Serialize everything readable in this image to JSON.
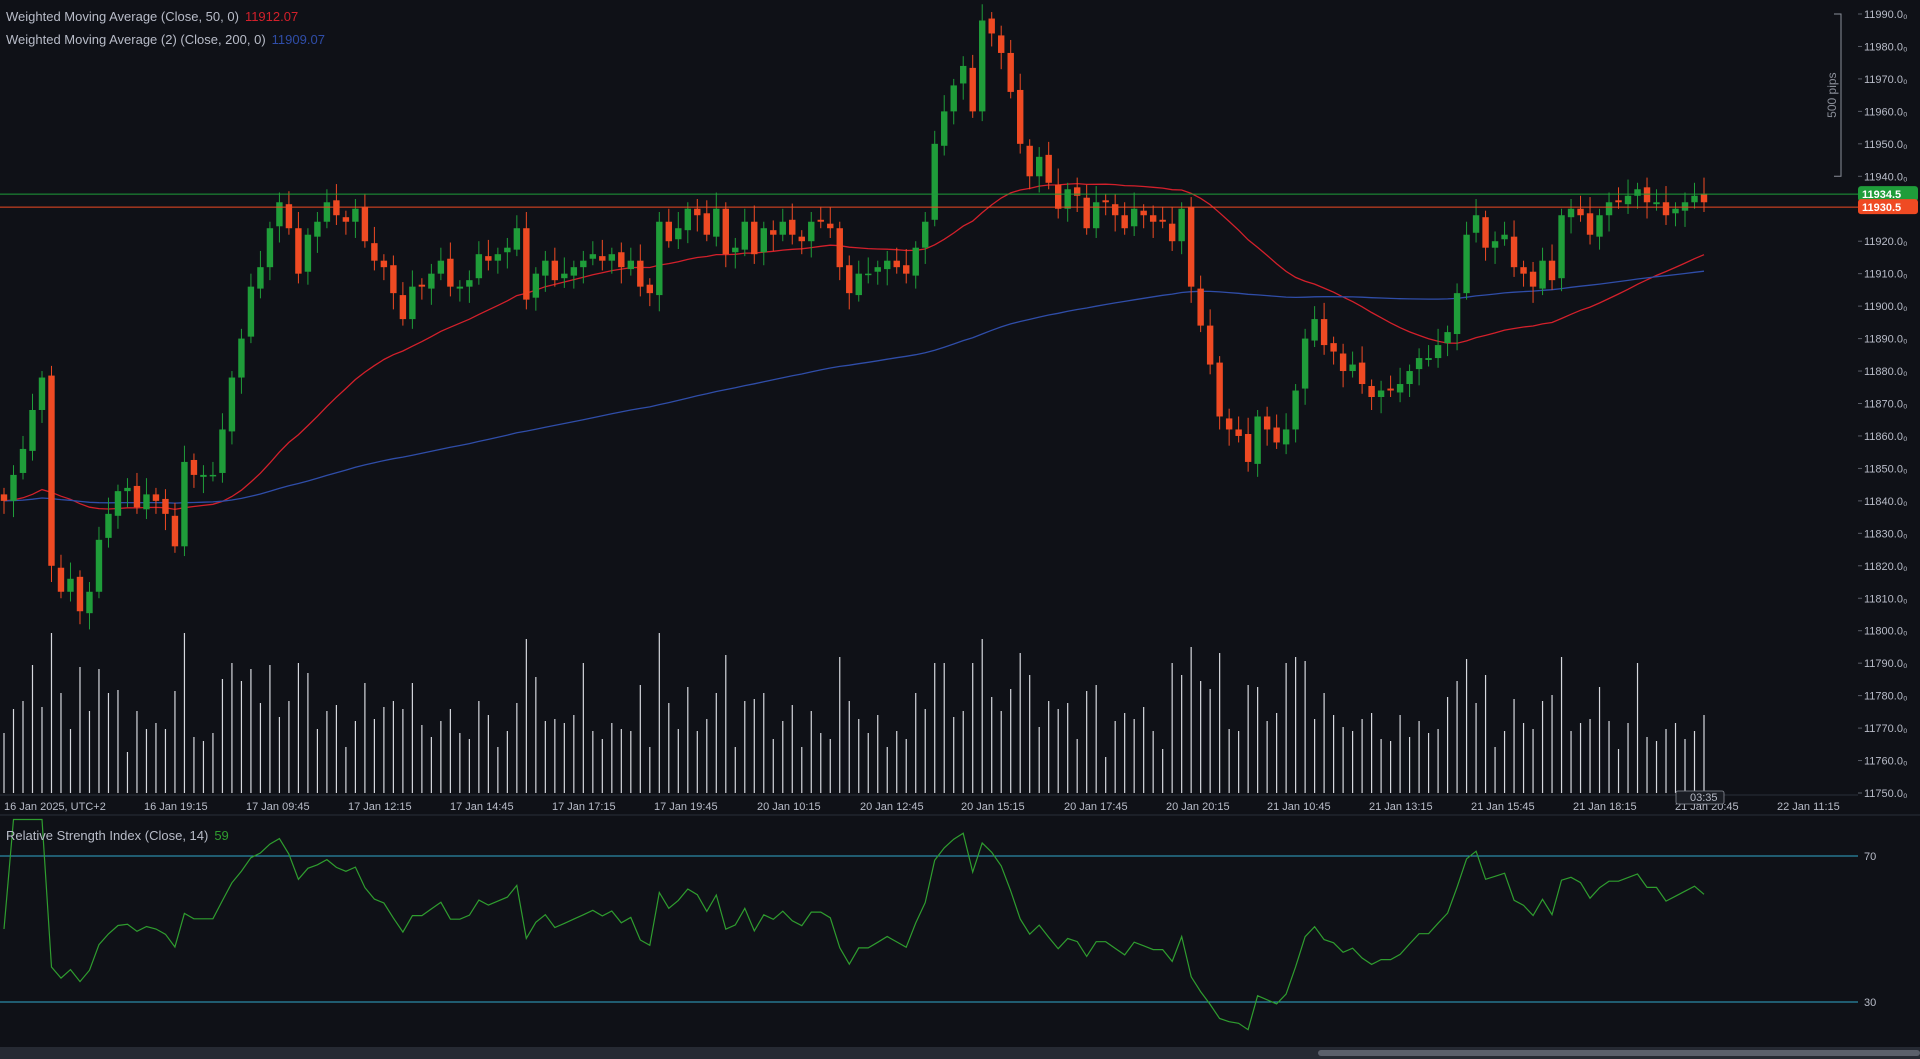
{
  "colors": {
    "background": "#0f1117",
    "up": "#1f9d3a",
    "down": "#ef4a23",
    "wma50": "#d3202b",
    "wma200": "#2f4da8",
    "volume": "#d6d8de",
    "rsi": "#2f9d2f",
    "rsi_band": "#30a6c9",
    "axis_text": "#b8bcc8"
  },
  "indicators": {
    "wma50_label": "Weighted Moving Average (Close, 50, 0)",
    "wma50_value": "11912.07",
    "wma200_label": "Weighted Moving Average (2) (Close, 200, 0)",
    "wma200_value": "11909.07",
    "rsi_label": "Relative Strength Index (Close, 14)",
    "rsi_value": "59"
  },
  "price_badges": {
    "green": "11934.5",
    "red": "11930.5"
  },
  "pips_label": "500 pips",
  "countdown": "03:35",
  "time_labels": [
    "16 Jan 2025, UTC+2",
    "16 Jan 19:15",
    "17 Jan 09:45",
    "17 Jan 12:15",
    "17 Jan 14:45",
    "17 Jan 17:15",
    "17 Jan 19:45",
    "20 Jan 10:15",
    "20 Jan 12:45",
    "20 Jan 15:15",
    "20 Jan 17:45",
    "20 Jan 20:15",
    "21 Jan 10:45",
    "21 Jan 13:15",
    "21 Jan 15:45",
    "21 Jan 18:15",
    "21 Jan 20:45",
    "22 Jan 11:15"
  ],
  "chart_data": {
    "type": "candlestick",
    "price_axis": {
      "min": 11750,
      "max": 11990,
      "step": 10,
      "tick_labels": [
        "11990.0",
        "11980.0",
        "11970.0",
        "11960.0",
        "11950.0",
        "11940.0",
        "11930.0",
        "11920.0",
        "11910.0",
        "11900.0",
        "11890.0",
        "11880.0",
        "11870.0",
        "11860.0",
        "11850.0",
        "11840.0",
        "11830.0",
        "11820.0",
        "11810.0",
        "11800.0",
        "11790.0",
        "11780.0",
        "11770.0",
        "11760.0",
        "11750.0"
      ]
    },
    "horizontal_lines": [
      {
        "name": "bid",
        "value": 11934.5,
        "color": "#1f9d3a"
      },
      {
        "name": "ask",
        "value": 11930.5,
        "color": "#ef4a23"
      }
    ],
    "closes": [
      11840,
      11848,
      11856,
      11868,
      11878,
      11820,
      11812,
      11816,
      11806,
      11812,
      11828,
      11836,
      11843,
      11844,
      11838,
      11842,
      11840,
      11836,
      11826,
      11852,
      11848,
      11848,
      11848,
      11862,
      11878,
      11890,
      11906,
      11912,
      11924,
      11932,
      11924,
      11910,
      11922,
      11926,
      11932,
      11928,
      11926,
      11930,
      11920,
      11914,
      11912,
      11904,
      11896,
      11906,
      11906,
      11910,
      11914,
      11906,
      11906,
      11908,
      11916,
      11914,
      11916,
      11918,
      11924,
      11902,
      11910,
      11914,
      11908,
      11910,
      11912,
      11914,
      11916,
      11914,
      11916,
      11912,
      11914,
      11906,
      11904,
      11926,
      11920,
      11924,
      11930,
      11928,
      11922,
      11930,
      11916,
      11918,
      11926,
      11916,
      11924,
      11922,
      11926,
      11922,
      11920,
      11926,
      11926,
      11924,
      11912,
      11904,
      11910,
      11910,
      11912,
      11914,
      11912,
      11910,
      11918,
      11926,
      11950,
      11960,
      11968,
      11974,
      11960,
      11988,
      11984,
      11978,
      11966,
      11950,
      11940,
      11946,
      11938,
      11930,
      11936,
      11934,
      11924,
      11932,
      11932,
      11928,
      11924,
      11930,
      11928,
      11926,
      11926,
      11920,
      11930,
      11906,
      11894,
      11882,
      11866,
      11862,
      11860,
      11852,
      11866,
      11862,
      11858,
      11862,
      11874,
      11890,
      11896,
      11888,
      11886,
      11880,
      11882,
      11876,
      11872,
      11874,
      11874,
      11876,
      11880,
      11884,
      11884,
      11888,
      11892,
      11904,
      11922,
      11928,
      11918,
      11920,
      11922,
      11912,
      11910,
      11906,
      11914,
      11908,
      11928,
      11930,
      11928,
      11922,
      11928,
      11932,
      11932,
      11934,
      11936,
      11932,
      11932,
      11928,
      11930,
      11932,
      11934,
      11932
    ]
  }
}
